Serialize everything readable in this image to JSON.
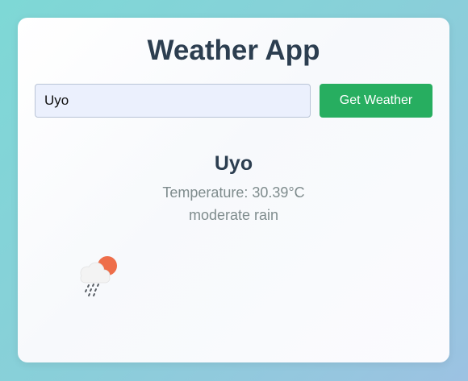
{
  "app": {
    "title": "Weather App"
  },
  "search": {
    "value": "Uyo",
    "button_label": "Get Weather"
  },
  "weather": {
    "city": "Uyo",
    "temperature": "Temperature: 30.39°C",
    "description": "moderate rain",
    "icon": "sun-behind-rain-cloud-icon"
  },
  "colors": {
    "accent": "#27ae60",
    "title": "#2c3e50",
    "muted": "#7f8c8d",
    "input_bg": "#ebf0fd"
  }
}
